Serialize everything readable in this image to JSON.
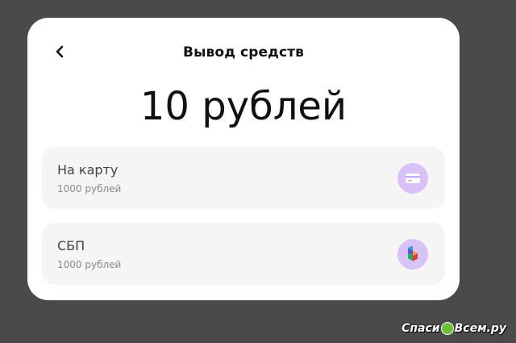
{
  "header": {
    "title": "Вывод средств",
    "back_icon": "chevron-left-icon"
  },
  "amount": "10 рублей",
  "options": [
    {
      "label": "На карту",
      "sub": "1000 рублей",
      "icon": "credit-card-icon",
      "icon_bg": "#d9c2f7"
    },
    {
      "label": "СБП",
      "sub": "1000 рублей",
      "icon": "sbp-logo-icon",
      "icon_bg": "#d9c2f7"
    }
  ],
  "watermark": {
    "left": "Спаси",
    "right": "Всем.ру"
  },
  "colors": {
    "background": "#4a4a4a",
    "card": "#ffffff",
    "option_bg": "#f5f5f6",
    "accent": "#a855f7"
  }
}
